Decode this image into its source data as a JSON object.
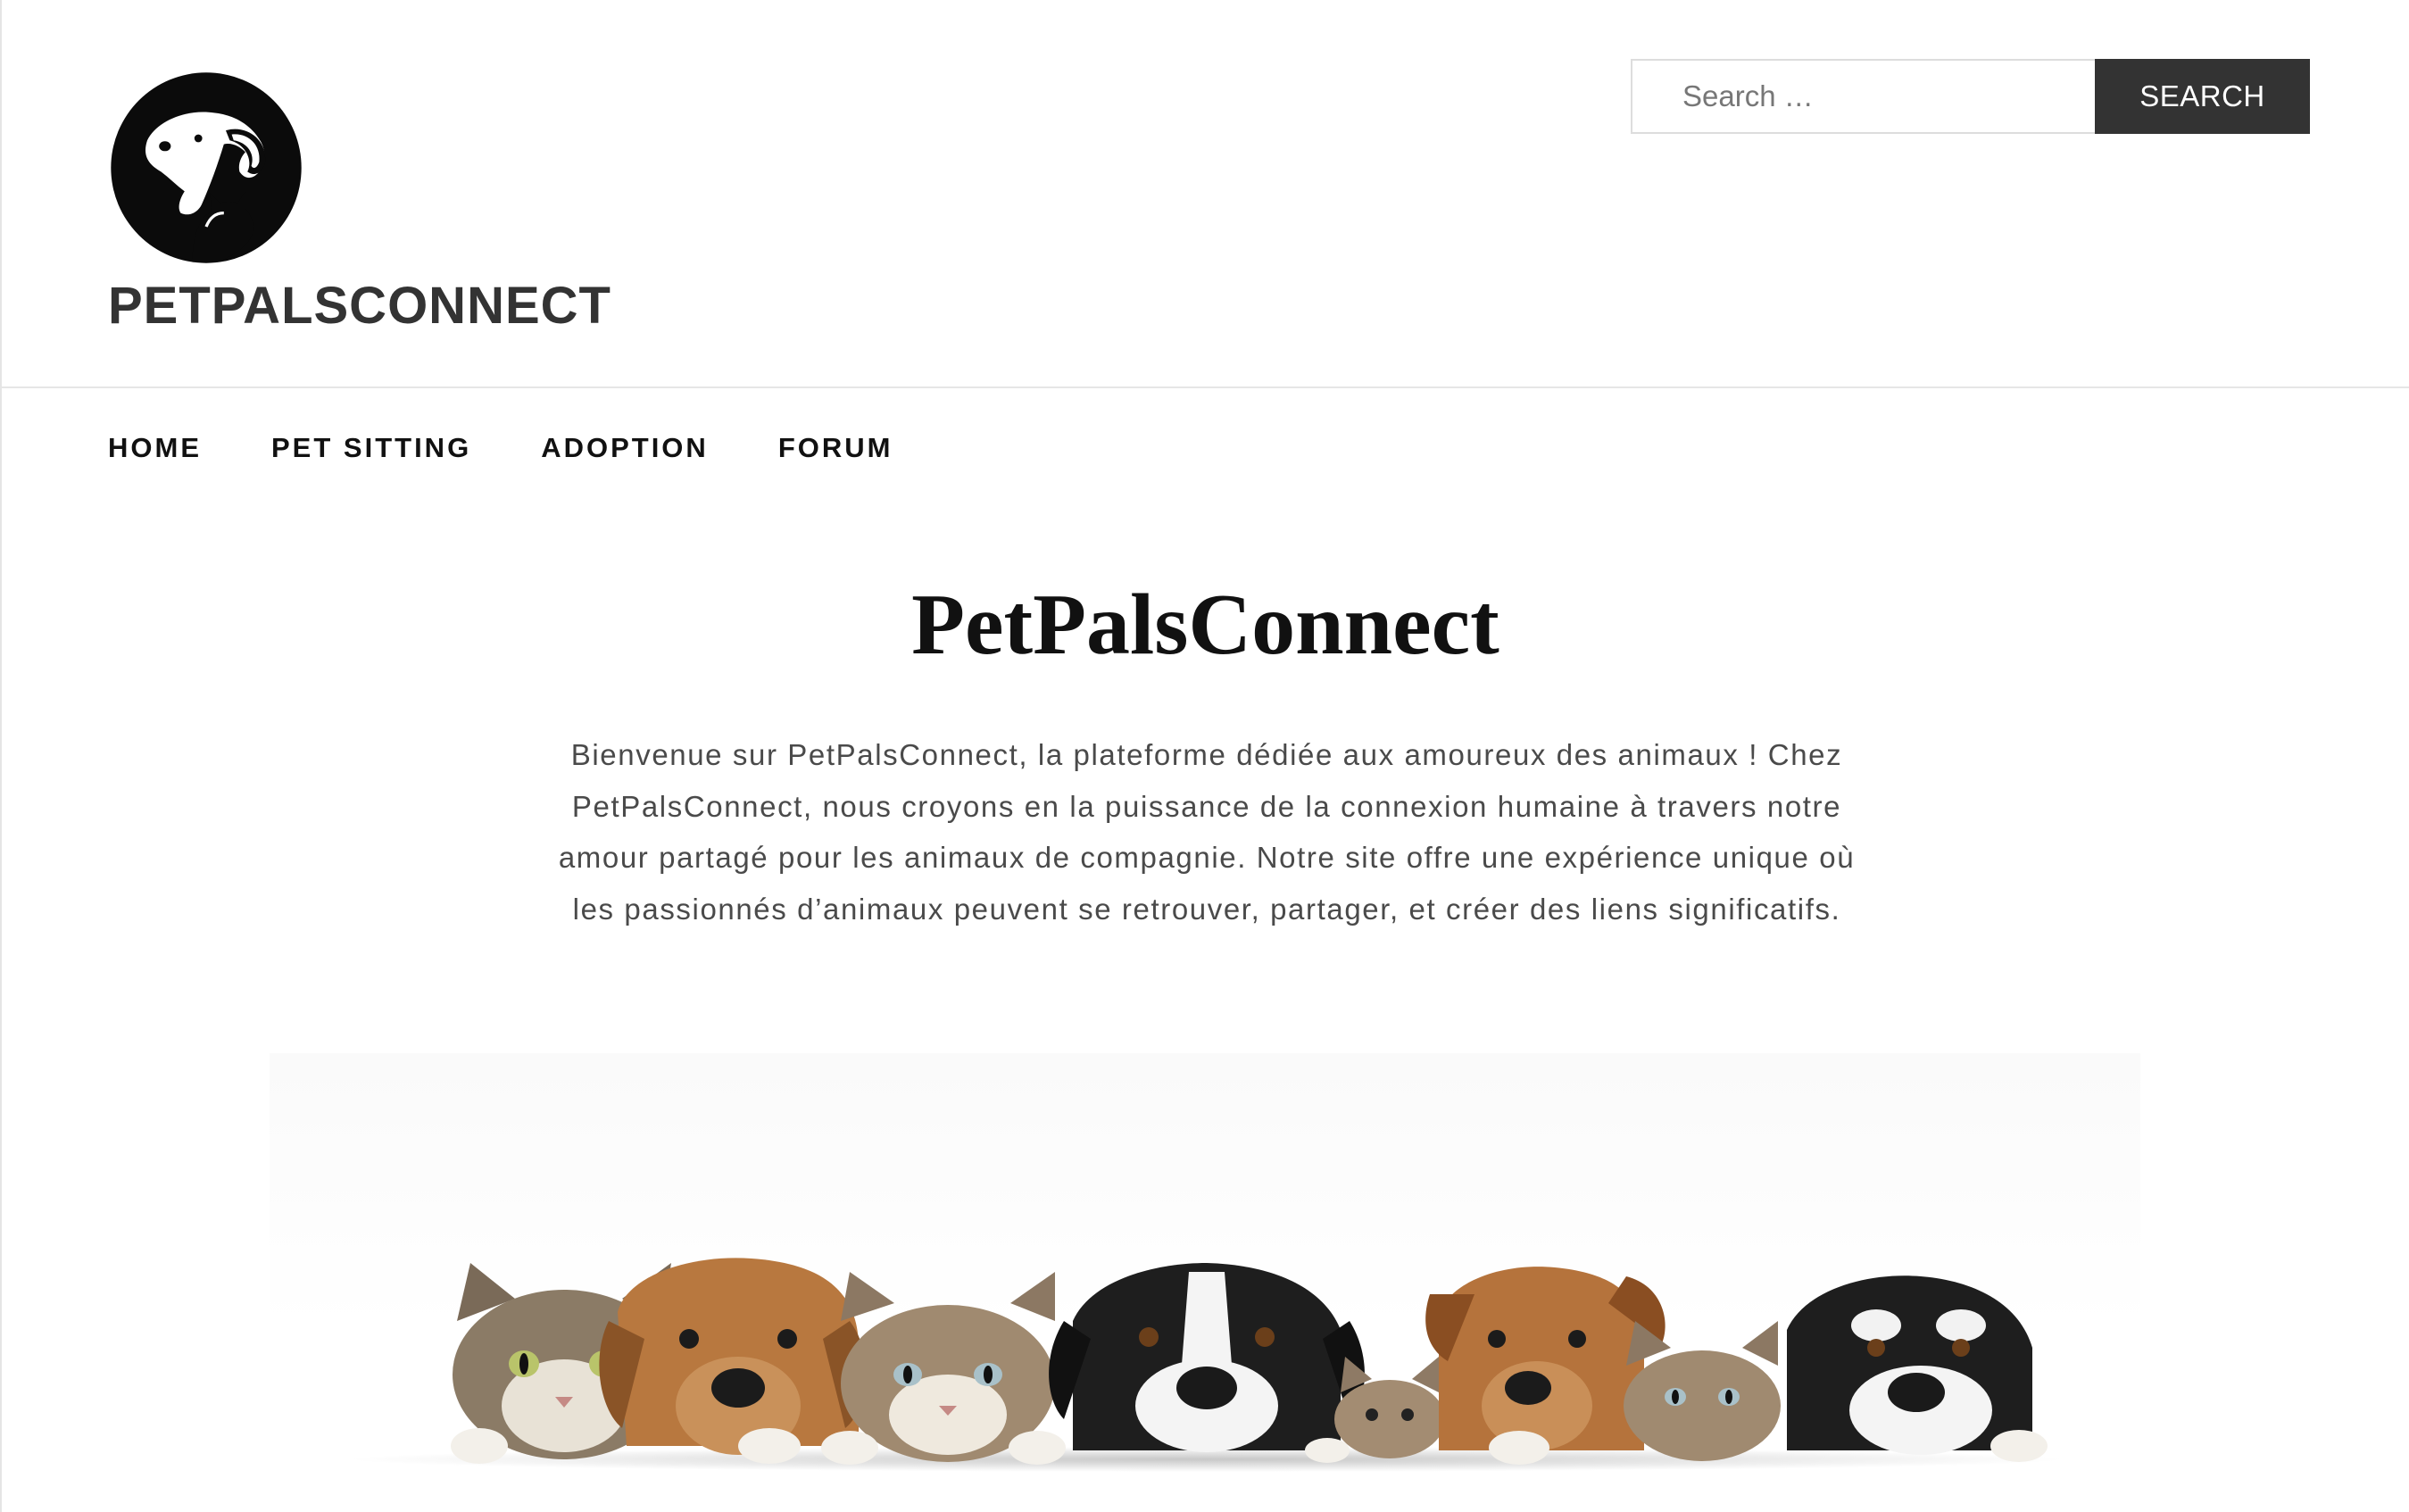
{
  "header": {
    "logo_icon": "dog-and-cat-silhouette-logo",
    "site_title": "PETPALSCONNECT",
    "search": {
      "placeholder": "Search …",
      "value": "",
      "button_label": "SEARCH"
    }
  },
  "nav": {
    "items": [
      {
        "label": "HOME"
      },
      {
        "label": "PET SITTING"
      },
      {
        "label": "ADOPTION"
      },
      {
        "label": "FORUM"
      }
    ]
  },
  "hero": {
    "title": "PetPalsConnect",
    "text": "Bienvenue sur PetPalsConnect, la plateforme dédiée aux amoureux des animaux ! Chez PetPalsConnect, nous croyons en la puissance de la connexion humaine à travers notre amour partagé pour les animaux de compagnie. Notre site offre une expérience unique où les passionnés d’animaux peuvent se retrouver, partager, et créer des liens significatifs.",
    "image": "row-of-cats-and-dogs-peeking-over-edge"
  },
  "colors": {
    "button_bg": "#333333",
    "title_text": "#333333",
    "body_text": "#4a4a4a"
  }
}
